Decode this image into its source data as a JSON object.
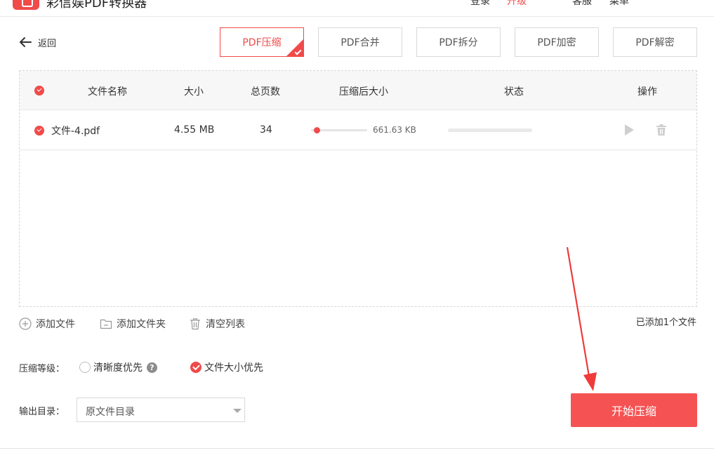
{
  "app": {
    "title": "彩信娱PDF转换器",
    "links": [
      "登录",
      "升级",
      "客服",
      "菜单"
    ]
  },
  "nav": {
    "back_label": "返回"
  },
  "tabs": [
    {
      "label": "PDF压缩",
      "active": true
    },
    {
      "label": "PDF合并",
      "active": false
    },
    {
      "label": "PDF拆分",
      "active": false
    },
    {
      "label": "PDF加密",
      "active": false
    },
    {
      "label": "PDF解密",
      "active": false
    }
  ],
  "table": {
    "headers": {
      "name": "文件名称",
      "size": "大小",
      "pages": "总页数",
      "compressed": "压缩后大小",
      "status": "状态",
      "ops": "操作"
    },
    "rows": [
      {
        "name": "文件-4.pdf",
        "size": "4.55 MB",
        "pages": "34",
        "compressed_size": "661.63 KB",
        "compression_slider": 0.05,
        "progress": 0
      }
    ]
  },
  "actions": {
    "add_file": "添加文件",
    "add_folder": "添加文件夹",
    "clear_list": "清空列表"
  },
  "file_count": "已添加1个文件",
  "compression": {
    "label": "压缩等级：",
    "options": [
      {
        "label": "清晰度优先",
        "selected": false
      },
      {
        "label": "文件大小优先",
        "selected": true
      }
    ]
  },
  "output": {
    "label": "输出目录：",
    "value": "原文件目录"
  },
  "start_button": "开始压缩",
  "colors": {
    "accent": "#f04a4a",
    "button": "#f55353",
    "header_bg": "#f7f7f7"
  }
}
